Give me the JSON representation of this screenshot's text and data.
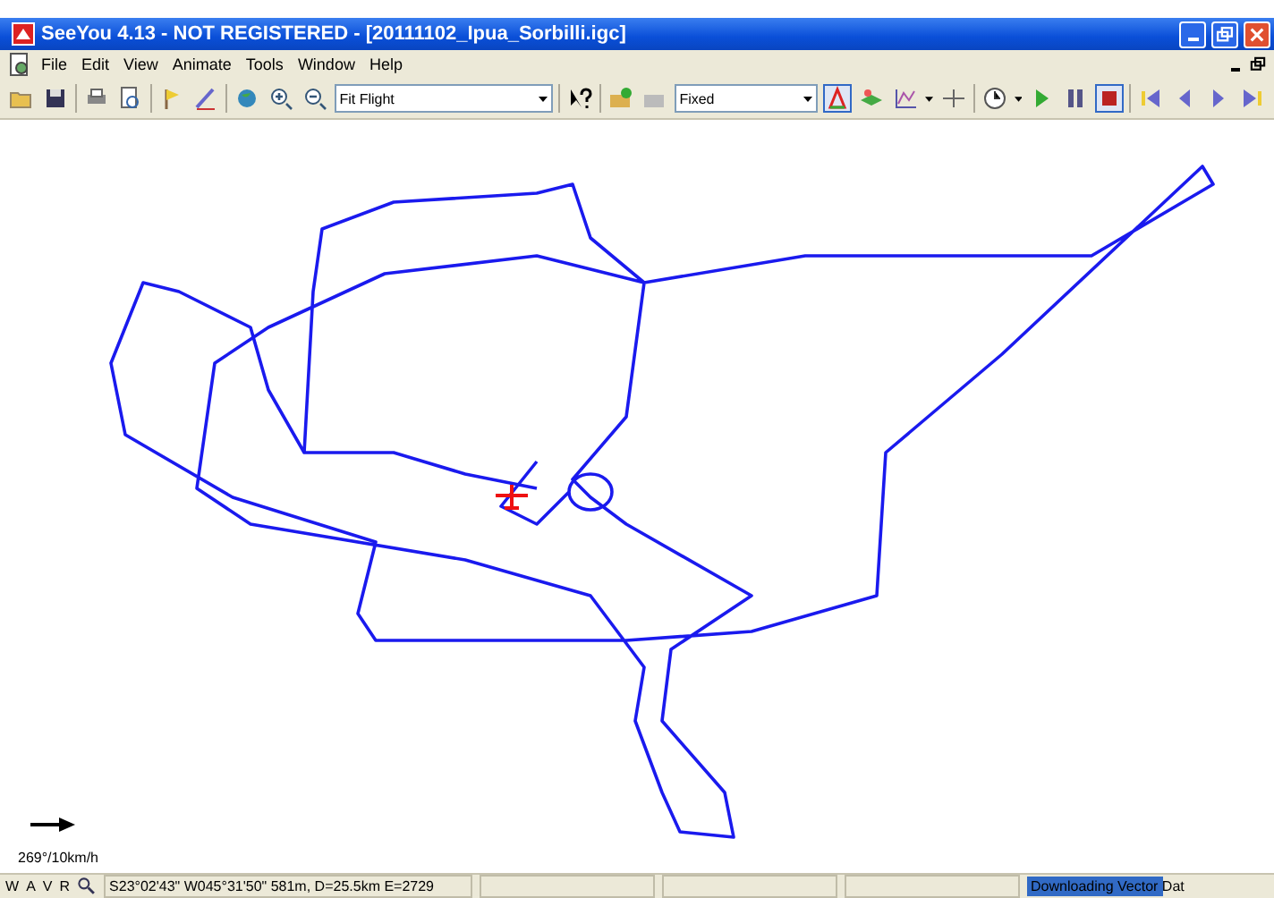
{
  "window": {
    "title": "SeeYou 4.13 - NOT REGISTERED - [20111102_Ipua_Sorbilli.igc]"
  },
  "menu": [
    "File",
    "Edit",
    "View",
    "Animate",
    "Tools",
    "Window",
    "Help"
  ],
  "toolbar": {
    "zoom_combo": "Fit Flight",
    "mode_combo": "Fixed",
    "task_tool": {
      "pressed": true
    },
    "stop_button": {
      "pressed": true
    }
  },
  "map": {
    "wind": "269°/10km/h"
  },
  "status_bar": {
    "layers": [
      "W",
      "A",
      "V",
      "R"
    ],
    "position": "S23°02'43\"  W045°31'50\" 581m, D=25.5km E=2729",
    "progress": {
      "text": "Downloading Vector Dat",
      "level": 0.55
    }
  }
}
